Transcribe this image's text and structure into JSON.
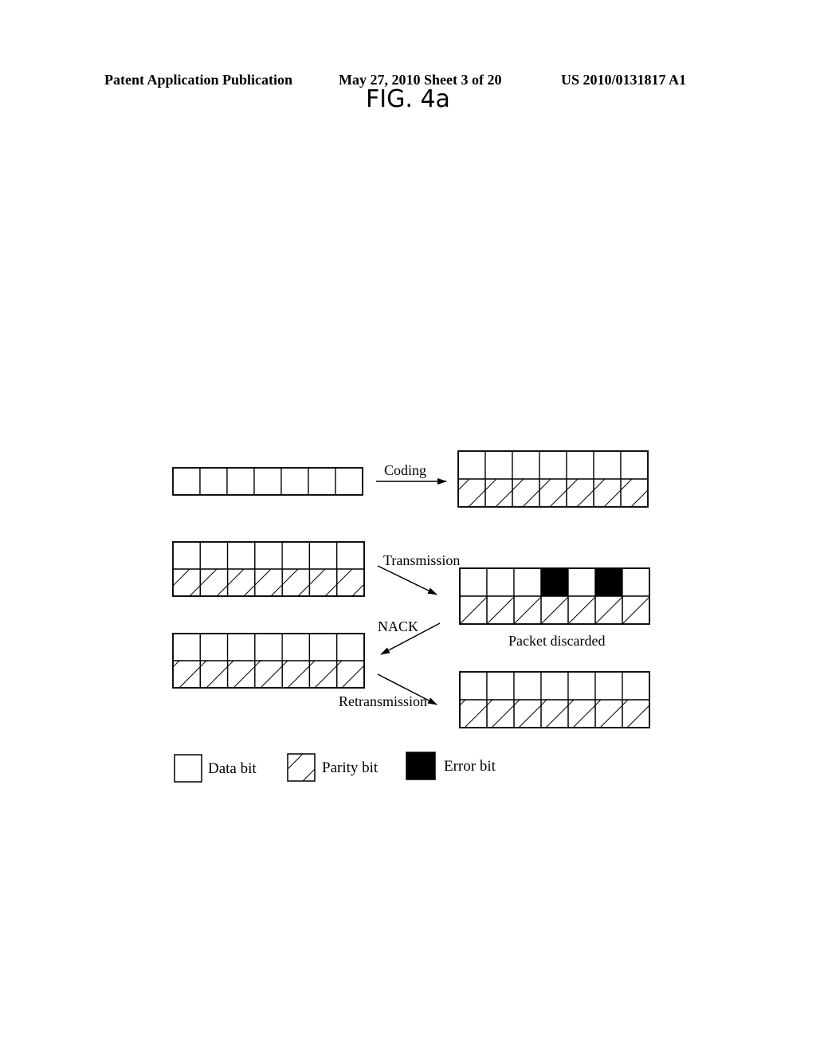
{
  "header": {
    "publication": "Patent Application Publication",
    "date_sheet": "May 27, 2010  Sheet 3 of 20",
    "patent_number": "US 2010/0131817 A1"
  },
  "figure": {
    "title": "FIG. 4a",
    "labels": {
      "coding": "Coding",
      "transmission": "Transmission",
      "nack": "NACK",
      "retransmission": "Retransmission",
      "packet_discarded": "Packet discarded"
    },
    "blocks": [
      {
        "id": "original-data",
        "cells": 7,
        "rows": [
          "data"
        ],
        "error_cells": []
      },
      {
        "id": "coded-packet",
        "cells": 7,
        "rows": [
          "data",
          "parity"
        ],
        "error_cells": []
      },
      {
        "id": "transmitted-packet",
        "cells": 7,
        "rows": [
          "data",
          "parity"
        ],
        "error_cells": []
      },
      {
        "id": "received-packet",
        "cells": 7,
        "rows": [
          "data",
          "parity"
        ],
        "error_cells": [
          4,
          6
        ]
      },
      {
        "id": "retransmit-source-packet",
        "cells": 7,
        "rows": [
          "data",
          "parity"
        ],
        "error_cells": []
      },
      {
        "id": "retransmitted-packet",
        "cells": 7,
        "rows": [
          "data",
          "parity"
        ],
        "error_cells": []
      }
    ],
    "legend": [
      {
        "key": "data",
        "label": "Data bit"
      },
      {
        "key": "parity",
        "label": "Parity bit"
      },
      {
        "key": "error",
        "label": "Error bit"
      }
    ]
  }
}
